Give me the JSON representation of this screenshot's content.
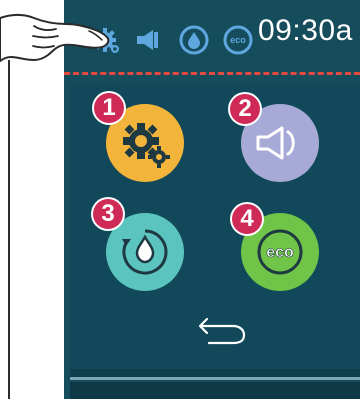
{
  "status_bar": {
    "time": "09:30a",
    "icons": [
      "gear-icon",
      "speaker-icon",
      "water-cycle-icon",
      "eco-icon"
    ]
  },
  "tiles": [
    {
      "number": "1",
      "icon": "gear-icon",
      "color": "#f2b43b"
    },
    {
      "number": "2",
      "icon": "speaker-icon",
      "color": "#a7a9d6"
    },
    {
      "number": "3",
      "icon": "water-cycle-icon",
      "color": "#5bc4be"
    },
    {
      "number": "4",
      "icon": "eco-icon",
      "color": "#70c447"
    }
  ],
  "colors": {
    "screen": "#154d5c",
    "dash": "#e2493f",
    "badge": "#cf2a57"
  }
}
